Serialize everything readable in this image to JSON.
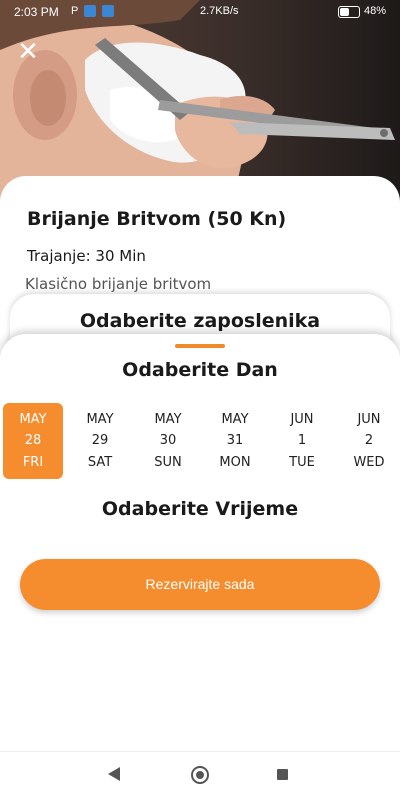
{
  "status_bar": {
    "time": "2:03 PM",
    "carrier_letter": "P",
    "net_speed": "2.7KB/s",
    "battery_pct": "48%",
    "battery_level": 0.48
  },
  "hero": {
    "icon": "close-icon",
    "close_glyph": "✕"
  },
  "service": {
    "title": "Brijanje Britvom (50 Kn)",
    "duration": "Trajanje: 30 Min",
    "description": "Klasično brijanje britvom"
  },
  "employee_section": {
    "title": "Odaberite zaposlenika"
  },
  "day_section": {
    "title": "Odaberite Dan",
    "days": [
      {
        "month": "MAY",
        "day": "28",
        "weekday": "FRI",
        "selected": true
      },
      {
        "month": "MAY",
        "day": "29",
        "weekday": "SAT",
        "selected": false
      },
      {
        "month": "MAY",
        "day": "30",
        "weekday": "SUN",
        "selected": false
      },
      {
        "month": "MAY",
        "day": "31",
        "weekday": "MON",
        "selected": false
      },
      {
        "month": "JUN",
        "day": "1",
        "weekday": "TUE",
        "selected": false
      },
      {
        "month": "JUN",
        "day": "2",
        "weekday": "WED",
        "selected": false
      }
    ]
  },
  "time_section": {
    "title": "Odaberite Vrijeme"
  },
  "book_button": {
    "label": "Rezervirajte sada"
  },
  "colors": {
    "accent": "#f58c2e",
    "text": "#1a1a1a"
  }
}
